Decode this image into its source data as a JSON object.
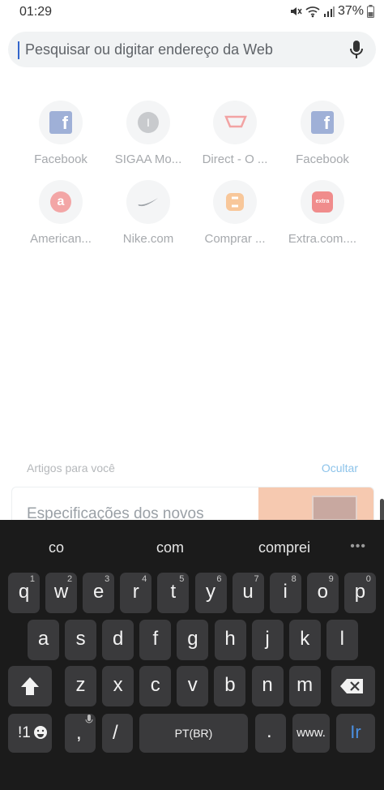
{
  "status": {
    "time": "01:29",
    "battery": "37%"
  },
  "search": {
    "placeholder": "Pesquisar ou digitar endereço da Web",
    "mic_icon": "mic-icon"
  },
  "shortcuts": [
    {
      "label": "Facebook",
      "icon": "facebook-icon"
    },
    {
      "label": "SIGAA Mo...",
      "icon": "sigaa-icon"
    },
    {
      "label": "Direct - O ...",
      "icon": "direct-icon"
    },
    {
      "label": "Facebook",
      "icon": "facebook-icon"
    },
    {
      "label": "American...",
      "icon": "americanas-icon"
    },
    {
      "label": "Nike.com",
      "icon": "nike-icon"
    },
    {
      "label": "Comprar ...",
      "icon": "comprar-icon"
    },
    {
      "label": "Extra.com....",
      "icon": "extra-icon"
    }
  ],
  "articles": {
    "title": "Artigos para você",
    "hide": "Ocultar",
    "card_title": "Especificações dos novos"
  },
  "keyboard": {
    "suggestions": [
      "co",
      "com",
      "comprei"
    ],
    "row1": [
      {
        "k": "q",
        "h": "1"
      },
      {
        "k": "w",
        "h": "2"
      },
      {
        "k": "e",
        "h": "3"
      },
      {
        "k": "r",
        "h": "4"
      },
      {
        "k": "t",
        "h": "5"
      },
      {
        "k": "y",
        "h": "6"
      },
      {
        "k": "u",
        "h": "7"
      },
      {
        "k": "i",
        "h": "8"
      },
      {
        "k": "o",
        "h": "9"
      },
      {
        "k": "p",
        "h": "0"
      }
    ],
    "row2": [
      "a",
      "s",
      "d",
      "f",
      "g",
      "h",
      "j",
      "k",
      "l"
    ],
    "row3": [
      "z",
      "x",
      "c",
      "v",
      "b",
      "n",
      "m"
    ],
    "symbols_label": "!1",
    "comma": ",",
    "slash": "/",
    "space_label": "PT(BR)",
    "period": ".",
    "www": "www.",
    "go": "Ir"
  },
  "colors": {
    "accent": "#3366cc",
    "go_key_text": "#4a90e2"
  }
}
